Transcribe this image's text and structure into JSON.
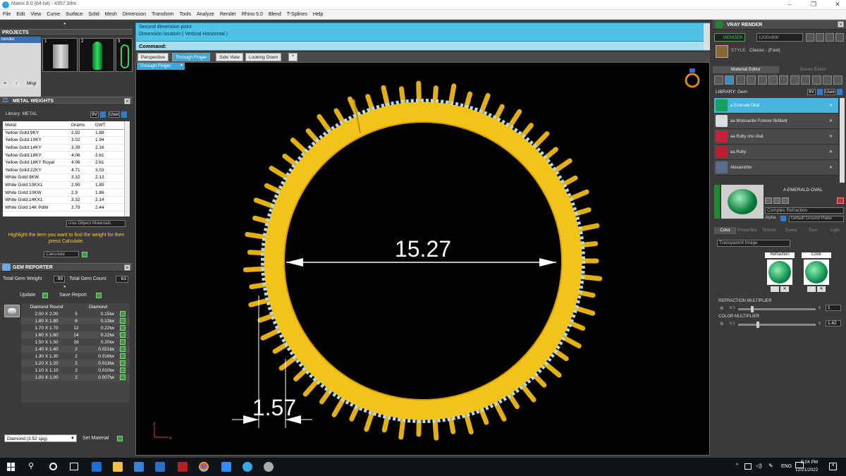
{
  "window": {
    "title": "Matrix 8.0 (64-bit) - 4357.3dm"
  },
  "menu": [
    "File",
    "Edit",
    "View",
    "Curve",
    "Surface",
    "Solid",
    "Mesh",
    "Dimension",
    "Transform",
    "Tools",
    "Analyze",
    "Render",
    "Rhino 5.0",
    "Blend",
    "T-Splines",
    "Help"
  ],
  "projects": {
    "title": "PROJECTS",
    "item": "render",
    "thumbs": [
      "1",
      "2",
      "3"
    ],
    "mngr": "Mngr"
  },
  "metal_weights": {
    "title": "METAL WEIGHTS",
    "library_label": "Library: METAL",
    "sv": "9V",
    "user": "User",
    "columns": [
      "Metal",
      "Grams",
      "DWT"
    ],
    "rows": [
      [
        "Yellow Gold:9KY",
        "2.92",
        "1.88"
      ],
      [
        "Yellow Gold:10KY",
        "3.02",
        "1.94"
      ],
      [
        "Yellow Gold:14KY",
        "3.39",
        "2.18"
      ],
      [
        "Yellow Gold:18KY",
        "4.06",
        "2.61"
      ],
      [
        "Yellow Gold:18KY Royal",
        "4.06",
        "2.61"
      ],
      [
        "Yellow Gold:22KY",
        "4.71",
        "3.03"
      ],
      [
        "White Gold:9KW",
        "3.32",
        "2.13"
      ],
      [
        "White Gold:10KX1",
        "2.95",
        "1.89"
      ],
      [
        "White Gold:10KW",
        "2.9",
        "1.86"
      ],
      [
        "White Gold:14KX1",
        "3.32",
        "2.14"
      ],
      [
        "White Gold:14K PdW",
        "3.79",
        "2.44"
      ]
    ],
    "use_object_materials": "Use Object Materials",
    "hint": "Highlight the item you want to find the weight for then press Calculate.",
    "calculate": "Calculate"
  },
  "gem_reporter": {
    "title": "GEM REPORTER",
    "total_weight_label": "Total Gem Weight",
    "total_weight": ".99",
    "total_count_label": "Total Gem Count",
    "total_count": "63",
    "update": "Update",
    "save_report": "Save Report",
    "col_shape": "Diamond Round",
    "col_type": "Diamond",
    "rows": [
      [
        "2.00 X 2.00",
        "5",
        "0.15tw"
      ],
      [
        "1.80 X 1.80",
        "6",
        "0.13tw"
      ],
      [
        "1.70 X 1.70",
        "12",
        "0.22tw"
      ],
      [
        "1.60 X 1.60",
        "14",
        "0.22tw"
      ],
      [
        "1.50 X 1.50",
        "16",
        "0.20tw"
      ],
      [
        "1.40 X 1.40",
        "2",
        "0.021tw"
      ],
      [
        "1.30 X 1.30",
        "2",
        "0.016tw"
      ],
      [
        "1.20 X 1.20",
        "2",
        "0.013tw"
      ],
      [
        "1.10 X 1.10",
        "2",
        "0.010tw"
      ],
      [
        "1.00 X 1.00",
        "2",
        "0.007tw"
      ]
    ],
    "material_select": "Diamond   (3.52 spg)",
    "set_material": "Set Material"
  },
  "command": {
    "line1": "Second dimension point",
    "line2": "Dimension location ( Vertical  Horizontal )",
    "prompt": "Command:"
  },
  "view_tabs": [
    "Perspective",
    "Through Finger",
    "Side View",
    "Looking Down"
  ],
  "active_view": "Through Finger",
  "viewport": {
    "dim_inner": "15.27",
    "dim_width": "1.57",
    "axis_z": "z",
    "axis_x": "x"
  },
  "vray": {
    "title": "VRAY RENDER",
    "render_btn": "RENDER",
    "resolution": "1200x900",
    "style_label": "STYLE",
    "style_value": "Classic - (Fast)",
    "tabs": [
      "Material Editor",
      "Scene Editor"
    ],
    "library": "LIBRARY: Gem",
    "materials": [
      {
        "name": "a Emerald Oval",
        "color": "#14a05a"
      },
      {
        "name": "aa Moissanite Forever Brilliant",
        "color": "#d8dde2"
      },
      {
        "name": "aa Ruby chu shat",
        "color": "#c8203a"
      },
      {
        "name": "aa Ruby",
        "color": "#c01830"
      },
      {
        "name": "Alexandrite",
        "color": "#5a6e8c"
      }
    ],
    "preview_name": "A EMERALD OVAL",
    "complex": "Complex Refraction",
    "alpha": "Alpha",
    "ground": "Default Ground Plane",
    "sub_tabs": [
      "Color",
      "Properties",
      "Texture",
      "Scene",
      "Toon",
      "Light"
    ],
    "transparent": "Transparent Image",
    "refraction_label": "Refraction",
    "color_label": "Color",
    "refraction_mult": "REFRACTION MULTIPLIER",
    "refraction_min": "0.1",
    "refraction_max": "5",
    "refraction_val": "1",
    "color_mult": "COLOR MULTIPLIER",
    "color_min": "0.1",
    "color_max": "5",
    "color_val": "1.42"
  },
  "taskbar": {
    "lang": "ENG",
    "time": "5:24 PM",
    "date": "12/21/2022",
    "notif": "4"
  }
}
